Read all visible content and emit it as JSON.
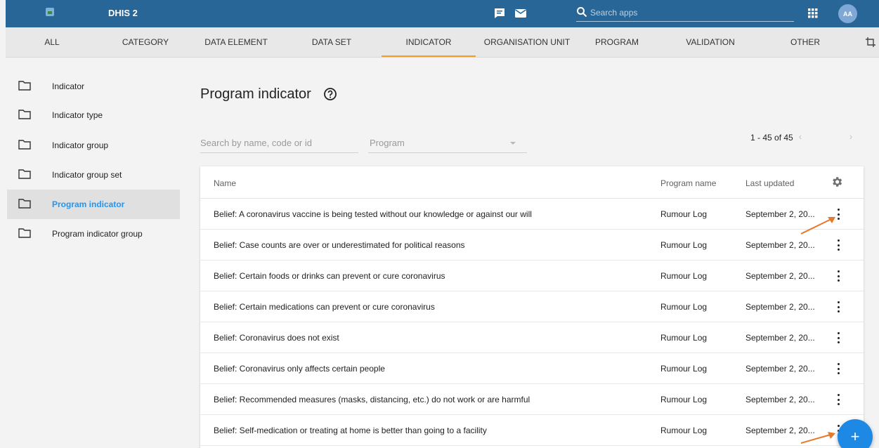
{
  "header": {
    "title": "DHIS 2",
    "search_placeholder": "Search apps",
    "avatar_initials": "AA"
  },
  "tabs": [
    {
      "label": "ALL",
      "active": false
    },
    {
      "label": "CATEGORY",
      "active": false
    },
    {
      "label": "DATA ELEMENT",
      "active": false
    },
    {
      "label": "DATA SET",
      "active": false
    },
    {
      "label": "INDICATOR",
      "active": true
    },
    {
      "label": "ORGANISATION UNIT",
      "active": false
    },
    {
      "label": "PROGRAM",
      "active": false
    },
    {
      "label": "VALIDATION",
      "active": false
    },
    {
      "label": "OTHER",
      "active": false
    }
  ],
  "sidebar": {
    "items": [
      {
        "label": "Indicator",
        "active": false
      },
      {
        "label": "Indicator type",
        "active": false
      },
      {
        "label": "Indicator group",
        "active": false
      },
      {
        "label": "Indicator group set",
        "active": false
      },
      {
        "label": "Program indicator",
        "active": true
      },
      {
        "label": "Program indicator group",
        "active": false
      }
    ]
  },
  "main": {
    "title": "Program indicator",
    "search_placeholder": "Search by name, code or id",
    "program_placeholder": "Program",
    "pager": "1 - 45 of 45",
    "columns": [
      "Name",
      "Program name",
      "Last updated"
    ],
    "rows": [
      {
        "name": "Belief: A coronavirus vaccine is being tested without our knowledge or against our will",
        "program": "Rumour Log",
        "updated": "September 2, 20..."
      },
      {
        "name": "Belief: Case counts are over or underestimated for political reasons",
        "program": "Rumour Log",
        "updated": "September 2, 20..."
      },
      {
        "name": "Belief: Certain foods or drinks can prevent or cure coronavirus",
        "program": "Rumour Log",
        "updated": "September 2, 20..."
      },
      {
        "name": "Belief: Certain medications can prevent or cure coronavirus",
        "program": "Rumour Log",
        "updated": "September 2, 20..."
      },
      {
        "name": "Belief: Coronavirus does not exist",
        "program": "Rumour Log",
        "updated": "September 2, 20..."
      },
      {
        "name": "Belief: Coronavirus only affects certain people",
        "program": "Rumour Log",
        "updated": "September 2, 20..."
      },
      {
        "name": "Belief: Recommended measures (masks, distancing, etc.) do not work or are harmful",
        "program": "Rumour Log",
        "updated": "September 2, 20..."
      },
      {
        "name": "Belief: Self-medication or treating at home is better than going to a facility",
        "program": "Rumour Log",
        "updated": "September 2, 20..."
      }
    ]
  },
  "fab_label": "+",
  "colors": {
    "header": "#276696",
    "tab_active": "#f39c2a",
    "link": "#2196f3",
    "fab": "#1e88e5",
    "annotation": "#e8782a"
  }
}
